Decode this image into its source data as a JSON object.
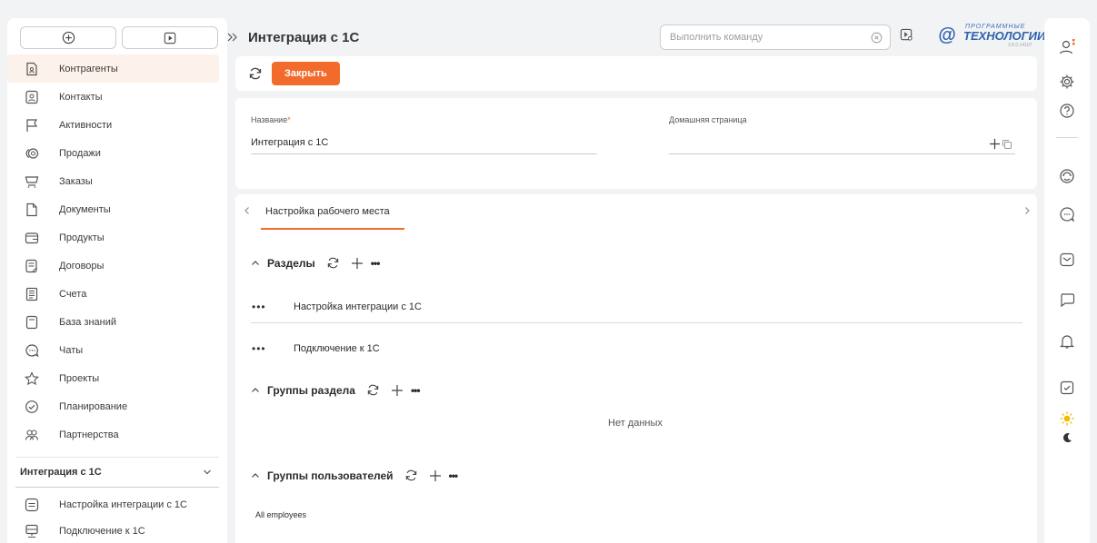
{
  "sidebar": {
    "top_buttons": [
      {
        "icon": "plus-circle-icon"
      },
      {
        "icon": "play-icon"
      }
    ],
    "items": [
      {
        "label": "Контрагенты",
        "icon": "document-person-icon",
        "active": true
      },
      {
        "label": "Контакты",
        "icon": "contact-card-icon"
      },
      {
        "label": "Активности",
        "icon": "flag-icon"
      },
      {
        "label": "Продажи",
        "icon": "coins-icon"
      },
      {
        "label": "Заказы",
        "icon": "cart-icon"
      },
      {
        "label": "Документы",
        "icon": "document-icon"
      },
      {
        "label": "Продукты",
        "icon": "wallet-icon"
      },
      {
        "label": "Договоры",
        "icon": "contract-icon"
      },
      {
        "label": "Счета",
        "icon": "invoice-icon"
      },
      {
        "label": "База знаний",
        "icon": "book-icon"
      },
      {
        "label": "Чаты",
        "icon": "chat-icon"
      },
      {
        "label": "Проекты",
        "icon": "star-icon"
      },
      {
        "label": "Планирование",
        "icon": "check-circle-icon"
      },
      {
        "label": "Партнерства",
        "icon": "partners-icon"
      }
    ],
    "section": {
      "label": "Интеграция с 1С",
      "icon": "chevron-down-icon"
    },
    "sub_items": [
      {
        "label": "Настройка интеграции с 1С",
        "icon": "settings-list-icon"
      },
      {
        "label": "Подключение к 1С",
        "icon": "server-icon"
      }
    ]
  },
  "header": {
    "title": "Интеграция с 1С",
    "command_placeholder": "Выполнить команду",
    "logo": {
      "line1": "ПРОГРАММНЫЕ",
      "line2": "ТЕХНОЛОГИИ",
      "version": "3.8.0.14107"
    }
  },
  "toolbar": {
    "close_label": "Закрыть"
  },
  "fields": {
    "name_label": "Название",
    "name_required_mark": "*",
    "name_value": "Интеграция с 1С",
    "homepage_label": "Домашняя страница",
    "homepage_value": ""
  },
  "tabs": [
    {
      "label": "Настройка рабочего места",
      "active": true
    }
  ],
  "sections": {
    "razdely": {
      "title": "Разделы",
      "rows": [
        "Настройка интеграции с 1С",
        "Подключение к 1С"
      ]
    },
    "gruppy": {
      "title": "Группы раздела",
      "empty_text": "Нет данных"
    },
    "polzovateli": {
      "title": "Группы пользователей",
      "rows": [
        "All employees"
      ]
    }
  },
  "colors": {
    "accent": "#f26b2c",
    "logo": "#2f62ad"
  }
}
